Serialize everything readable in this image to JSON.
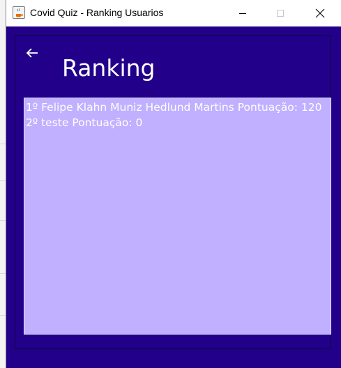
{
  "window": {
    "title": "Covid Quiz - Ranking Usuarios",
    "icon": "java-icon",
    "buttons": [
      "minimize",
      "maximize",
      "close"
    ]
  },
  "screen": {
    "back_icon": "back-arrow-icon",
    "heading": "Ranking"
  },
  "ranking": {
    "items": [
      {
        "text": "1º Felipe Klahn Muniz Hedlund Martins Pontuação: 120"
      },
      {
        "text": "2º teste Pontuação: 0"
      }
    ]
  },
  "colors": {
    "background": "#22008a",
    "list_background": "#c0b0ff",
    "text": "#ffffff"
  }
}
